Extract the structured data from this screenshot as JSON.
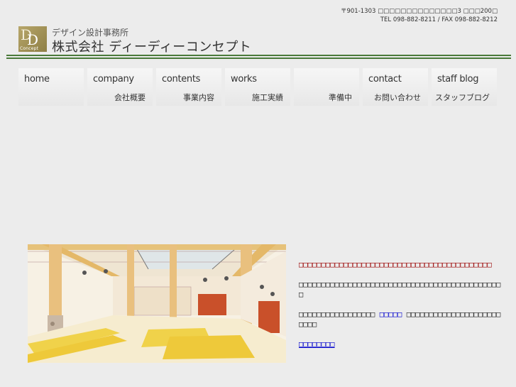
{
  "header": {
    "address_line1": "〒901-1303 □□□□□□□□□□□□□□3 □□□200□",
    "address_line2": "TEL 098-882-8211 / FAX 098-882-8212",
    "logo_text_main": "D",
    "logo_text_sub": "Concept",
    "tagline": "デザイン設計事務所",
    "company_name": "株式会社 ディーディーコンセプト"
  },
  "nav": {
    "items": [
      {
        "en": "home",
        "jp": ""
      },
      {
        "en": "company",
        "jp": "会社概要"
      },
      {
        "en": "contents",
        "jp": "事業内容"
      },
      {
        "en": "works",
        "jp": "施工実績"
      },
      {
        "en": "",
        "jp": "準備中"
      },
      {
        "en": "contact",
        "jp": "お問い合わせ"
      },
      {
        "en": "staff blog",
        "jp": "スタッフブログ"
      }
    ]
  },
  "main": {
    "lead": "□□□□□□□□□□□□□□□□□□□□□□□□□□□□□□□□□□□□□□□□□□□",
    "body1": "□□□□□□□□□□□□□□□□□□□□□□□□□□□□□□□□□□□□□□□□□□□□□□",
    "body2_pre": "□□□□□□□□□□□□□□□□□",
    "body2_link": "□□□□□",
    "body2_post": "□□□□□□□□□□□□□□□□□□□□□□□□□",
    "footer_link": "□□□□□□□□"
  },
  "colors": {
    "rule_green": "#4a7a3a",
    "lead_red": "#990000",
    "link_blue": "#0000cc",
    "logo_gold": "#a3944f"
  }
}
